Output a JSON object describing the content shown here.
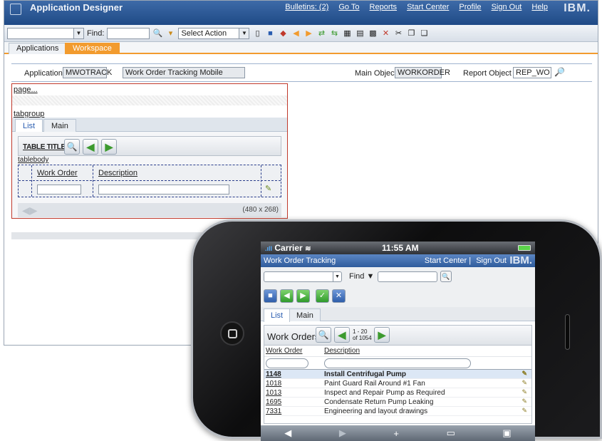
{
  "app": {
    "title": "Application Designer",
    "nav": {
      "bulletins": "Bulletins: (2)",
      "goto": "Go To",
      "reports": "Reports",
      "start_center": "Start Center",
      "profile": "Profile",
      "sign_out": "Sign Out",
      "help": "Help"
    },
    "brand": "IBM."
  },
  "toolbar": {
    "find_label": "Find:",
    "action_select": "Select Action"
  },
  "tabs": [
    "Applications",
    "Workspace"
  ],
  "header": {
    "application_label": "Application",
    "application_value": "MWOTRACK",
    "description_value": "Work Order Tracking Mobile",
    "main_object_label": "Main Object",
    "main_object_value": "WORKORDER",
    "report_object_label": "Report Object",
    "report_object_value": "REP_WO"
  },
  "design": {
    "page_link": "page...",
    "tabgroup_link": "tabgroup",
    "tabs": [
      "List",
      "Main"
    ],
    "table_title": "TABLE TITLE",
    "tablebody_label": "tablebody",
    "columns": [
      "Work Order",
      "Description"
    ],
    "dimensions": "(480 x 268)"
  },
  "phone": {
    "status": {
      "carrier": "Carrier",
      "time": "11:55 AM"
    },
    "header": {
      "title": "Work Order Tracking",
      "start_center": "Start Center",
      "sign_out": "Sign Out",
      "brand": "IBM."
    },
    "find_label": "Find",
    "tabs": [
      "List",
      "Main"
    ],
    "list_title": "Work Orders",
    "range_line1": "1 - 20",
    "range_line2": "of 1054",
    "columns": [
      "Work Order",
      "Description"
    ],
    "rows": [
      {
        "wo": "1148",
        "desc": "Install Centrifugal Pump"
      },
      {
        "wo": "1018",
        "desc": "Paint Guard Rail Around #1 Fan"
      },
      {
        "wo": "1013",
        "desc": "Inspect and Repair Pump as Required"
      },
      {
        "wo": "1695",
        "desc": "Condensate Return Pump Leaking"
      },
      {
        "wo": "7331",
        "desc": "Engineering and layout drawings"
      }
    ]
  }
}
